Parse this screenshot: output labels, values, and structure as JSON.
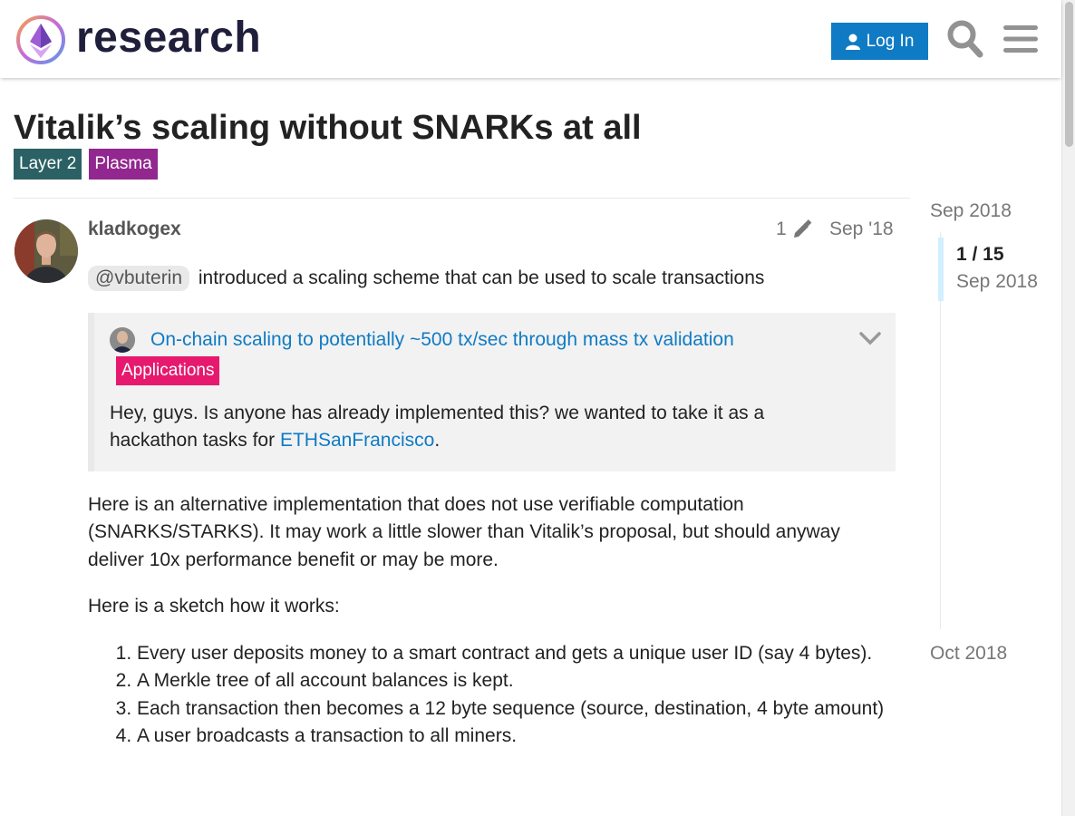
{
  "header": {
    "logo_text": "research",
    "login_label": "Log In",
    "icons": [
      "ethereum-research-logo-icon",
      "user-icon",
      "search-icon",
      "hamburger-menu-icon"
    ]
  },
  "topic": {
    "title": "Vitalik’s scaling without SNARKs at all",
    "tags": [
      {
        "label": "Layer 2",
        "color": "#2b6165"
      },
      {
        "label": "Plasma",
        "color": "#92278f"
      }
    ]
  },
  "post": {
    "username": "kladkogex",
    "edit_count": "1",
    "date": "Sep '18",
    "mention": "@vbuterin",
    "intro_text": "introduced a scaling scheme that can be used to scale transactions",
    "onebox": {
      "title": "On-chain scaling to potentially ~500 tx/sec through mass tx validation",
      "tag": "Applications",
      "tag_color": "#e6196e",
      "quote_text": "Hey, guys. Is anyone has already implemented this? we wanted to take it as a hackathon tasks for ",
      "quote_link": "ETHSanFrancisco",
      "quote_end": "."
    },
    "paragraph_1": "Here is an alternative implementation that does not use verifiable computation (SNARKS/STARKS). It may work a little slower than Vitalik’s proposal, but should anyway deliver 10x performance benefit or may be more.",
    "paragraph_2": "Here is a sketch how it works:",
    "steps": [
      "Every user deposits money to a smart contract and gets a unique user ID (say 4 bytes).",
      "A Merkle tree of all account balances is kept.",
      "Each transaction then becomes a 12 byte sequence (source, destination, 4 byte amount)",
      "A user broadcasts a transaction to all miners."
    ]
  },
  "timeline": {
    "start_label": "Sep 2018",
    "position": "1 / 15",
    "current_date": "Sep 2018",
    "end_label": "Oct 2018"
  },
  "colors": {
    "accent": "#0f7bc4",
    "text": "#222222",
    "muted": "#777777"
  }
}
